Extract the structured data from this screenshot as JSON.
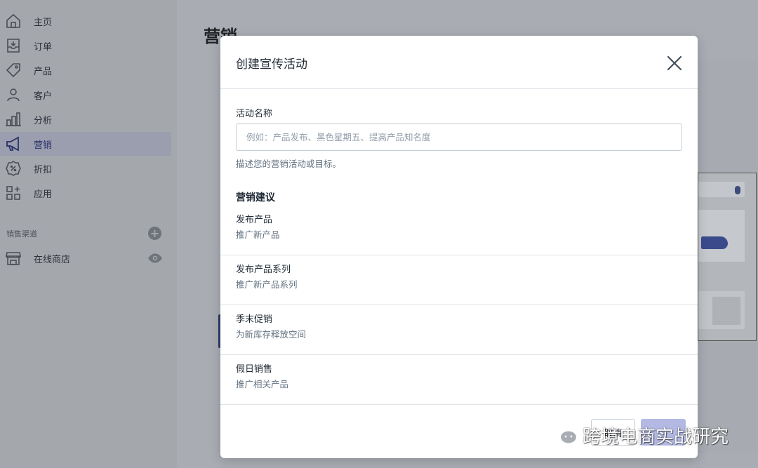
{
  "sidebar": {
    "items": [
      {
        "label": "主页",
        "icon": "home-icon"
      },
      {
        "label": "订单",
        "icon": "orders-inbox-icon"
      },
      {
        "label": "产品",
        "icon": "tag-icon"
      },
      {
        "label": "客户",
        "icon": "person-icon"
      },
      {
        "label": "分析",
        "icon": "bar-chart-icon"
      },
      {
        "label": "营销",
        "icon": "megaphone-icon",
        "active": true
      },
      {
        "label": "折扣",
        "icon": "discount-icon"
      },
      {
        "label": "应用",
        "icon": "apps-icon"
      }
    ],
    "sales_channels_title": "销售渠道",
    "channels": [
      {
        "label": "在线商店",
        "icon": "store-icon"
      }
    ]
  },
  "main": {
    "page_title": "营销"
  },
  "modal": {
    "title": "创建宣传活动",
    "field_label": "活动名称",
    "field_placeholder": "例如：产品发布、黑色星期五、提高产品知名度",
    "field_value": "",
    "help_text": "描述您的营销活动或目标。",
    "suggestions_title": "营销建议",
    "suggestions": [
      {
        "title": "发布产品",
        "desc": "推广新产品"
      },
      {
        "title": "发布产品系列",
        "desc": "推广新产品系列"
      },
      {
        "title": "季末促销",
        "desc": "为新库存释放空间"
      },
      {
        "title": "假日销售",
        "desc": "推广相关产品"
      }
    ],
    "cancel_label": "取消",
    "primary_label": ""
  },
  "watermark": {
    "text": "跨境电商实战研究"
  },
  "colors": {
    "accent": "#5c6ac4",
    "primary_disabled": "#b3b9e3",
    "active_nav_bg": "#9a9eaf"
  }
}
